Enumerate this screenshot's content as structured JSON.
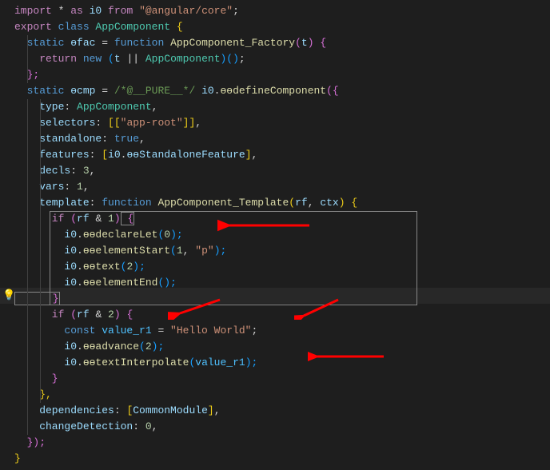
{
  "code": {
    "l1_import": "import",
    "l1_star": " * ",
    "l1_as": "as",
    "l1_i0": " i0 ",
    "l1_from": "from",
    "l1_mod": " \"@angular/core\"",
    "l1_semi": ";",
    "l2_export": "export",
    "l2_class": " class",
    "l2_name": " AppComponent",
    "l2_brace": " {",
    "l3_static": "  static",
    "l3_fac": " ɵfac",
    "l3_eq": " = ",
    "l3_fn": "function",
    "l3_fname": " AppComponent_Factory",
    "l3_paren": "(",
    "l3_t": "t",
    "l3_paren2": ")",
    "l3_brace": " {",
    "l4_ret": "    return",
    "l4_new": " new",
    "l4_p1": " (",
    "l4_t": "t",
    "l4_or": " || ",
    "l4_app": "AppComponent",
    "l4_p2": ")()",
    "l4_semi": ";",
    "l5_close": "  };",
    "l6_static": "  static",
    "l6_cmp": " ɵcmp",
    "l6_eq": " = ",
    "l6_pure": "/*@__PURE__*/",
    "l6_i0": " i0",
    "l6_dot": ".",
    "l6_def": "ɵɵdefineComponent",
    "l6_p1": "({",
    "l7_type": "    type",
    "l7_col": ": ",
    "l7_app": "AppComponent",
    "l7_comma": ",",
    "l8_sel": "    selectors",
    "l8_col": ": ",
    "l8_arr": "[[",
    "l8_str": "\"app-root\"",
    "l8_arr2": "]]",
    "l8_comma": ",",
    "l9_stand": "    standalone",
    "l9_col": ": ",
    "l9_true": "true",
    "l9_comma": ",",
    "l10_feat": "    features",
    "l10_col": ": ",
    "l10_arr": "[",
    "l10_i0": "i0",
    "l10_dot": ".",
    "l10_sf": "ɵɵStandaloneFeature",
    "l10_arr2": "]",
    "l10_comma": ",",
    "l11_decls": "    decls",
    "l11_col": ": ",
    "l11_num": "3",
    "l11_comma": ",",
    "l12_vars": "    vars",
    "l12_col": ": ",
    "l12_num": "1",
    "l12_comma": ",",
    "l13_tmpl": "    template",
    "l13_col": ": ",
    "l13_fn": "function",
    "l13_fname": " AppComponent_Template",
    "l13_p1": "(",
    "l13_rf": "rf",
    "l13_c": ", ",
    "l13_ctx": "ctx",
    "l13_p2": ")",
    "l13_brace": " {",
    "l14_if": "      if",
    "l14_p1": " (",
    "l14_rf": "rf",
    "l14_amp": " & ",
    "l14_num": "1",
    "l14_p2": ")",
    "l14_brace": " {",
    "l15_i0": "        i0",
    "l15_dot": ".",
    "l15_fn": "ɵɵdeclareLet",
    "l15_p1": "(",
    "l15_num": "0",
    "l15_p2": ");",
    "l16_i0": "        i0",
    "l16_dot": ".",
    "l16_fn": "ɵɵelementStart",
    "l16_p1": "(",
    "l16_num": "1",
    "l16_c": ", ",
    "l16_str": "\"p\"",
    "l16_p2": ");",
    "l17_i0": "        i0",
    "l17_dot": ".",
    "l17_fn": "ɵɵtext",
    "l17_p1": "(",
    "l17_num": "2",
    "l17_p2": ");",
    "l18_i0": "        i0",
    "l18_dot": ".",
    "l18_fn": "ɵɵelementEnd",
    "l18_p1": "();",
    "l19_close": "      }",
    "l20_if": "      if",
    "l20_p1": " (",
    "l20_rf": "rf",
    "l20_amp": " & ",
    "l20_num": "2",
    "l20_p2": ")",
    "l20_brace": " {",
    "l21_const": "        const",
    "l21_var": " value_r1",
    "l21_eq": " = ",
    "l21_str": "\"Hello World\"",
    "l21_semi": ";",
    "l22_i0": "        i0",
    "l22_dot": ".",
    "l22_fn": "ɵɵadvance",
    "l22_p1": "(",
    "l22_num": "2",
    "l22_p2": ");",
    "l23_i0": "        i0",
    "l23_dot": ".",
    "l23_fn": "ɵɵtextInterpolate",
    "l23_p1": "(",
    "l23_var": "value_r1",
    "l23_p2": ");",
    "l24_close": "      }",
    "l25_close": "    },",
    "l26_deps": "    dependencies",
    "l26_col": ": ",
    "l26_arr": "[",
    "l26_cm": "CommonModule",
    "l26_arr2": "]",
    "l26_comma": ",",
    "l27_cd": "    changeDetection",
    "l27_col": ": ",
    "l27_num": "0",
    "l27_comma": ",",
    "l28_close": "  });",
    "l29_close": "}"
  },
  "arrow_color": "#ff0000"
}
